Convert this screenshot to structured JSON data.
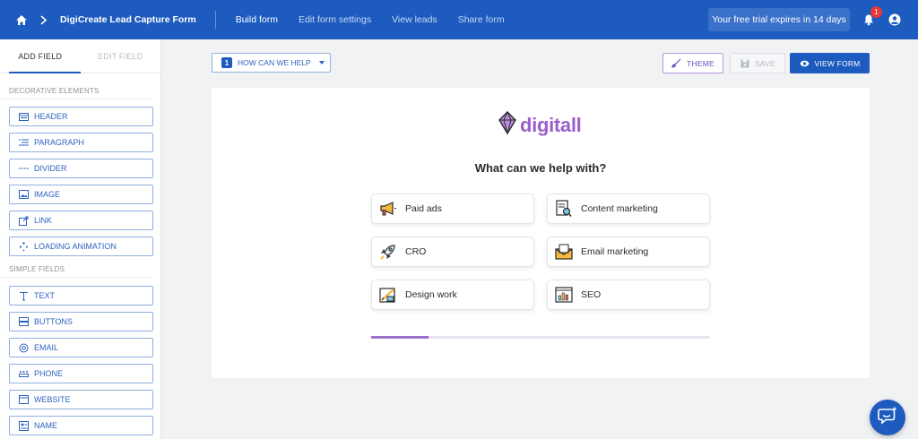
{
  "topbar": {
    "title": "DigiCreate Lead Capture Form",
    "nav": [
      "Build form",
      "Edit form settings",
      "View leads",
      "Share form"
    ],
    "active_nav": "Build form",
    "trial": "Your free trial expires in 14 days",
    "notification_count": "1"
  },
  "sidebar": {
    "tabs": {
      "add_field": "ADD FIELD",
      "edit_field": "EDIT FIELD"
    },
    "decorative_label": "DECORATIVE ELEMENTS",
    "decorative": [
      "HEADER",
      "PARAGRAPH",
      "DIVIDER",
      "IMAGE",
      "LINK",
      "LOADING ANIMATION"
    ],
    "simple_label": "SIMPLE FIELDS",
    "simple": [
      "TEXT",
      "BUTTONS",
      "EMAIL",
      "PHONE",
      "WEBSITE",
      "NAME"
    ]
  },
  "toolbar": {
    "step_number": "1",
    "step_label": "HOW CAN WE HELP",
    "theme": "THEME",
    "save": "SAVE",
    "view_form": "VIEW FORM"
  },
  "form": {
    "logo_text": "digitall",
    "question": "What can we help with?",
    "options": [
      "Paid ads",
      "Content marketing",
      "CRO",
      "Email marketing",
      "Design work",
      "SEO"
    ],
    "progress": 0.17
  },
  "colors": {
    "primary": "#1d5bbf",
    "brand_purple": "#9b5fc9"
  }
}
